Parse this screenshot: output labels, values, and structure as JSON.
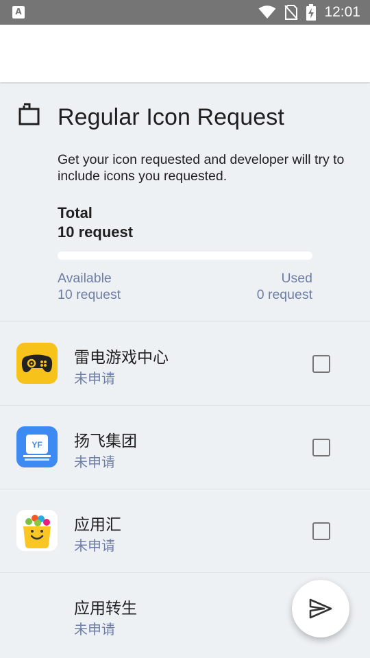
{
  "status_bar": {
    "notification_icon": "a-font-icon",
    "time": "12:01",
    "icons": [
      "wifi-icon",
      "no-sim-icon",
      "battery-charging-icon"
    ]
  },
  "request_card": {
    "icon": "folder-open-icon",
    "title": "Regular Icon Request",
    "description": "Get your icon requested and developer will try to include icons you requested.",
    "total_label": "Total",
    "total_value": "10 request",
    "used_fraction": 0,
    "available_label": "Available",
    "available_value": "10 request",
    "used_label": "Used",
    "used_value": "0 request"
  },
  "apps": [
    {
      "name": "雷电游戏中心",
      "status": "未申请",
      "icon": "gamepad-app-icon",
      "icon_color": "#f7c21a",
      "checked": false
    },
    {
      "name": "扬飞集团",
      "status": "未申请",
      "icon": "yf-app-icon",
      "icon_color": "#3d8bf2",
      "checked": false
    },
    {
      "name": "应用汇",
      "status": "未申请",
      "icon": "shopping-bag-app-icon",
      "icon_color": "#ffffff",
      "checked": false
    },
    {
      "name": "应用转生",
      "status": "未申请",
      "icon": "",
      "icon_color": "",
      "checked": false
    }
  ],
  "fab": {
    "icon": "send-icon"
  }
}
